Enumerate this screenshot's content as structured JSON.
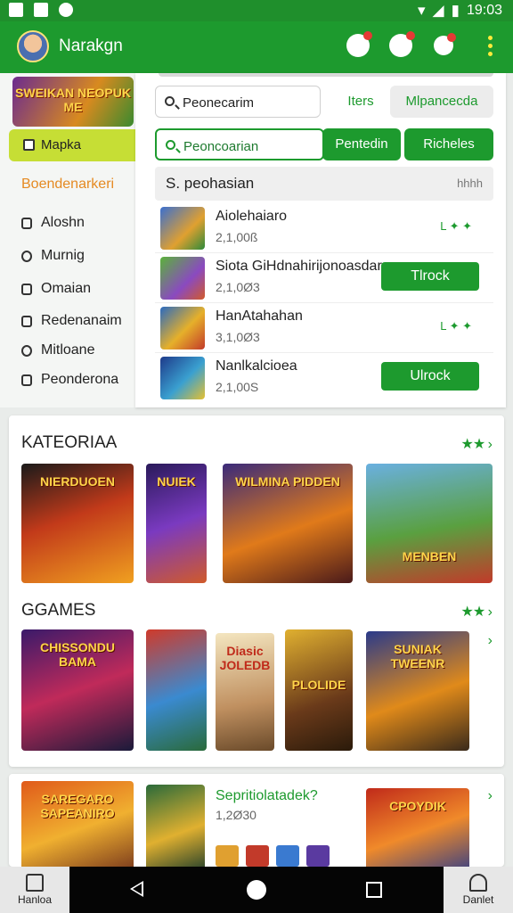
{
  "status": {
    "time": "19:03"
  },
  "appbar": {
    "title": "Narakgn"
  },
  "sidebar": {
    "banner": "SWEIKAN NEOPUK ME",
    "active": "Mapka",
    "section": "Boendenarkeri",
    "items": [
      "Aloshn",
      "Murnig",
      "Omaian",
      "Redenanaim",
      "Mitloane",
      "Peonderona"
    ]
  },
  "search": {
    "query1": "Peonecarim",
    "chip1": "Iters",
    "chip2": "Mlpancecda",
    "query2": "Peoncoarian",
    "btn1": "Pentedin",
    "btn2": "Richeles",
    "result_title": "S. peohasian",
    "result_more": "hhhh"
  },
  "results": [
    {
      "name": "Aiolehaiaro",
      "count": "2,1,00ß",
      "stars": "L ✦ ✦",
      "action": ""
    },
    {
      "name": "Siota GiHdnahirijonoasdar",
      "count": "2,1,0Ø3",
      "stars": "",
      "action": "Tlrock"
    },
    {
      "name": "HanAtahahan",
      "count": "3,1,0Ø3",
      "stars": "L ✦ ✦",
      "action": ""
    },
    {
      "name": "Nanlkalcioea",
      "count": "2,1,00S",
      "stars": "",
      "action": "Ulrock"
    }
  ],
  "categories": {
    "title": "KATEORIAA",
    "tiles": [
      "NIERDUOEN",
      "NUIEK",
      "WILMINA PIDDEN",
      "MENBEN"
    ]
  },
  "games": {
    "title": "GGAMES",
    "tiles": [
      "CHISSONDU BAMA",
      "",
      "Diasic JOLEDB",
      "PLOLIDE",
      "SUNIAK TWEENR"
    ]
  },
  "featured": {
    "tile1": "SAREGARO SAPEANIRO",
    "name": "Sepritiolatadek?",
    "count": "1,2Ø30",
    "tile3": "CPOYDIK"
  },
  "nav": {
    "home": "Hanloa",
    "profile": "Danlet"
  },
  "colors": {
    "primary": "#1d9a2e",
    "accent": "#c6de35",
    "section": "#e58a22"
  }
}
